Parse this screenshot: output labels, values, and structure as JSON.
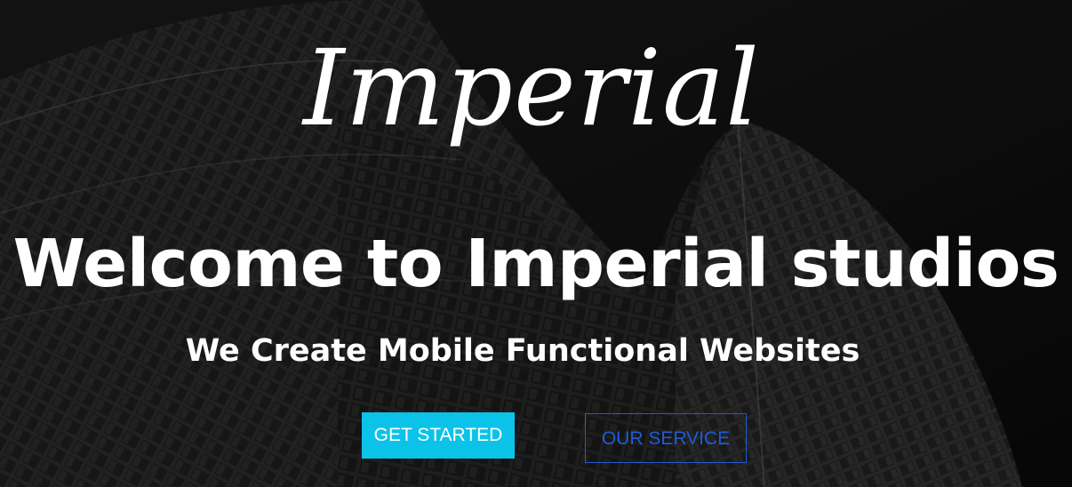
{
  "brand": {
    "logo_text": "Imperial"
  },
  "hero": {
    "headline": "Welcome to Imperial studios",
    "subheadline": "We Create Mobile Functional Websites"
  },
  "buttons": {
    "get_started_label": "GET STARTED",
    "our_service_label": "OUR SERVICE"
  },
  "colors": {
    "primary_button": "#0bc3e9",
    "outline_button": "#1f5bd6",
    "text": "#ffffff"
  }
}
